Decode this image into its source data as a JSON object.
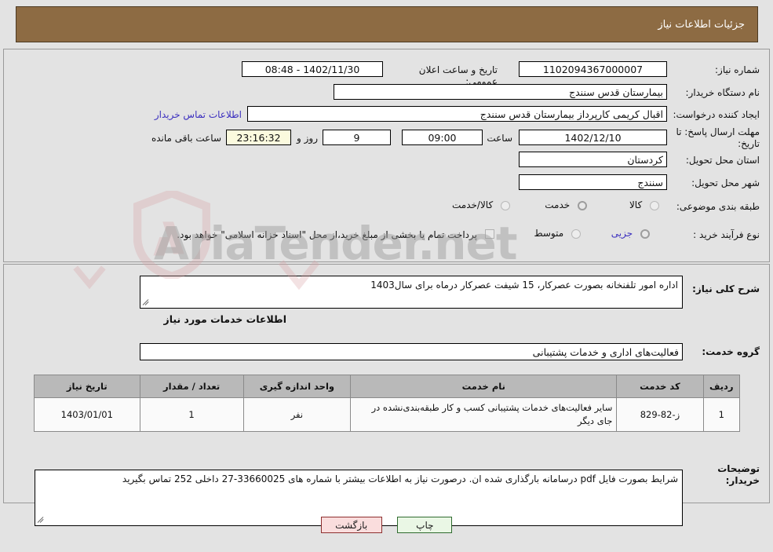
{
  "header": {
    "title": "جزئیات اطلاعات نیاز"
  },
  "fields": {
    "need_number_label": "شماره نیاز:",
    "need_number_value": "1102094367000007",
    "announce_datetime_label": "تاریخ و ساعت اعلان عمومی:",
    "announce_datetime_value": "1402/11/30 - 08:48",
    "buyer_org_label": "نام دستگاه خریدار:",
    "buyer_org_value": "بیمارستان قدس سنندج",
    "creator_label": "ایجاد کننده درخواست:",
    "creator_value": "اقبال کریمی کارپرداز بیمارستان قدس سنندج",
    "buyer_contact_link": "اطلاعات تماس خریدار",
    "deadline_label": "مهلت ارسال پاسخ: تا تاریخ:",
    "deadline_date": "1402/12/10",
    "deadline_time_label": "ساعت",
    "deadline_time": "09:00",
    "days_value": "9",
    "days_suffix": "روز و",
    "countdown_value": "23:16:32",
    "countdown_suffix": "ساعت باقی مانده",
    "province_label": "استان محل تحویل:",
    "province_value": "کردستان",
    "city_label": "شهر محل تحویل:",
    "city_value": "سنندج",
    "category_label": "طبقه بندی موضوعی:",
    "category_options": [
      "کالا",
      "خدمت",
      "کالا/خدمت"
    ],
    "category_selected": "خدمت",
    "process_label": "نوع فرآیند خرید :",
    "process_options": [
      "جزیی",
      "متوسط"
    ],
    "process_selected": "جزیی",
    "treasury_note": "پرداخت تمام یا بخشی از مبلغ خرید،از محل \"اسناد خزانه اسلامی\" خواهد بود."
  },
  "description": {
    "label": "شرح کلی نیاز:",
    "value": "اداره امور تلفنخانه بصورت عصرکار، 15 شیفت عصرکار درماه برای سال1403"
  },
  "services_section": {
    "heading": "اطلاعات خدمات مورد نیاز",
    "group_label": "گروه خدمت:",
    "group_value": "فعالیت‌های اداری و خدمات پشتیبانی"
  },
  "items_table": {
    "columns": [
      "ردیف",
      "کد خدمت",
      "نام خدمت",
      "واحد اندازه گیری",
      "تعداد / مقدار",
      "تاریخ نیاز"
    ],
    "rows": [
      {
        "row": "1",
        "code": "ز-82-829",
        "name": "سایر فعالیت‌های خدمات پشتیبانی کسب و کار طبقه‌بندی‌نشده در جای دیگر",
        "unit": "نفر",
        "qty": "1",
        "date": "1403/01/01"
      }
    ]
  },
  "buyer_notes": {
    "label": "توضیحات خریدار:",
    "value": "شرایط بصورت فایل pdf درسامانه بارگذاری شده ان. درصورت نیاز به اطلاعات بیشتر با شماره های 33660025-27 داخلی 252 تماس بگیرید"
  },
  "buttons": {
    "print": "چاپ",
    "back": "بازگشت"
  },
  "watermark": {
    "text": "AriaTender.net"
  },
  "colors": {
    "header_bg": "#8d6b43",
    "page_bg": "#e3e3e3",
    "table_header_bg": "#b9b9b9",
    "link": "#3b2fbf",
    "print_btn_bg": "#eaf7e5",
    "back_btn_bg": "#fadddd"
  }
}
